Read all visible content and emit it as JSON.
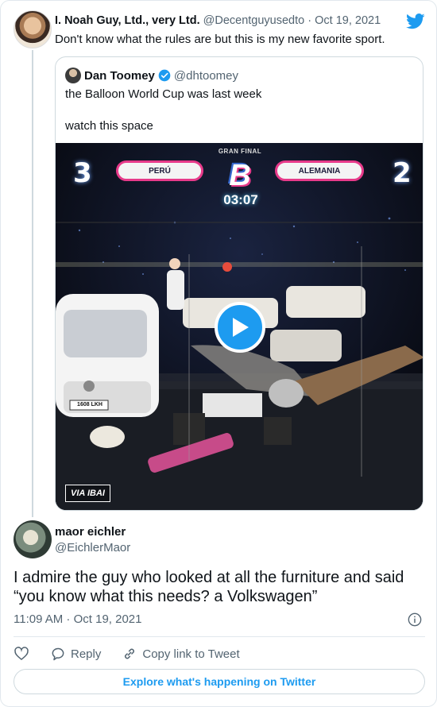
{
  "parent_tweet": {
    "name": "I. Noah Guy, Ltd., very Ltd.",
    "handle": "@Decentguyusedto",
    "date": "Oct 19, 2021",
    "text": "Don't know what the rules are but this is my new favorite sport."
  },
  "quoted_tweet": {
    "name": "Dan Toomey",
    "handle": "@dhtoomey",
    "line1": "the Balloon World Cup was last week",
    "line2": "watch this space",
    "video": {
      "banner": "GRAN FINAL",
      "team_left": "PERÚ",
      "team_right": "ALEMANIA",
      "score_left": "3",
      "score_right": "2",
      "timer": "03:07",
      "logo_letter": "B",
      "plate": "1608 LKH",
      "watermark": "VIA IBAI"
    }
  },
  "reply": {
    "name": "maor eichler",
    "handle": "@EichlerMaor",
    "text": "I admire the guy who looked at all the furniture and said “you know what this needs? a Volkswagen”",
    "timestamp": "11:09 AM · Oct 19, 2021"
  },
  "actions": {
    "reply_label": "Reply",
    "copy_label": "Copy link to Tweet"
  },
  "explore_label": "Explore what's happening on Twitter",
  "colors": {
    "accent": "#1d9bf0",
    "muted": "#536471",
    "border": "#cfd9de"
  }
}
